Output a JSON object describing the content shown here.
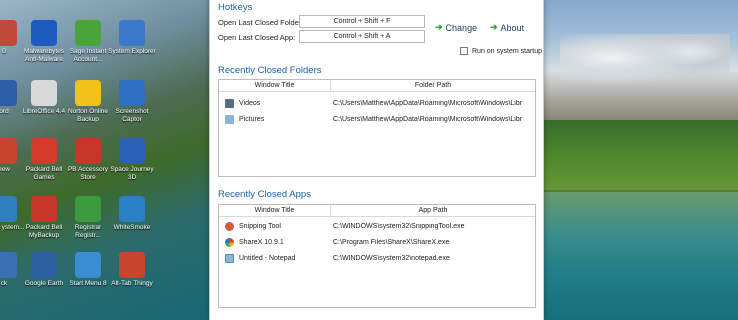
{
  "desktop": {
    "icons": [
      {
        "label": "G",
        "color": "#c04a3a"
      },
      {
        "label": "Malwarebytes Anti-Malware",
        "color": "#1e5bbf"
      },
      {
        "label": "Sage Instant Account...",
        "color": "#4aa33a"
      },
      {
        "label": "System Explorer",
        "color": "#3a78c9"
      },
      {
        "label": "ord",
        "color": "#2c5fa8"
      },
      {
        "label": "LibreOffice 4.4",
        "color": "#d8d8d8"
      },
      {
        "label": "Norton Online Backup",
        "color": "#f2c21b"
      },
      {
        "label": "Screenshot Captor",
        "color": "#2e6fc2"
      },
      {
        "label": "hew",
        "color": "#c8442e"
      },
      {
        "label": "Packard Bell Games",
        "color": "#d43a2a"
      },
      {
        "label": "PB Accessory Store",
        "color": "#c8362a"
      },
      {
        "label": "Space Journey 3D",
        "color": "#2b60b8"
      },
      {
        "label": "ontrol ystem...",
        "color": "#2f7fbf"
      },
      {
        "label": "Packard Bell MyBackup",
        "color": "#c8362a"
      },
      {
        "label": "Registrar Registr...",
        "color": "#3b9a3b"
      },
      {
        "label": "WhiteSmoke",
        "color": "#2a7fc6"
      },
      {
        "label": "ck",
        "color": "#3a6fb5"
      },
      {
        "label": "Google Earth",
        "color": "#2a5fa0"
      },
      {
        "label": "Start Menu 8",
        "color": "#3a8dd0"
      },
      {
        "label": "Alt-Tab Thingy",
        "color": "#c8442e"
      }
    ]
  },
  "window": {
    "hotkeys": {
      "title": "Hotkeys",
      "folder_label": "Open Last Closed Folder:",
      "folder_value": "Control + Shift + F",
      "app_label": "Open Last Closed App:",
      "app_value": "Control + Shift + A",
      "change_label": "Change",
      "about_label": "About",
      "startup_label": "Run on system startup"
    },
    "folders": {
      "title": "Recently Closed Folders",
      "col1": "Window Title",
      "col2": "Folder Path",
      "rows": [
        {
          "title": "Videos",
          "path": "C:\\Users\\Matthew\\AppData\\Roaming\\Microsoft\\Windows\\Libr"
        },
        {
          "title": "Pictures",
          "path": "C:\\Users\\Matthew\\AppData\\Roaming\\Microsoft\\Windows\\Libr"
        }
      ]
    },
    "apps": {
      "title": "Recently Closed Apps",
      "col1": "Window Title",
      "col2": "App Path",
      "rows": [
        {
          "title": "Snipping Tool",
          "path": "C:\\WINDOWS\\system32\\SnippingTool.exe"
        },
        {
          "title": "ShareX 10.9.1",
          "path": "C:\\Program Files\\ShareX\\ShareX.exe"
        },
        {
          "title": "Untitled - Notepad",
          "path": "C:\\WINDOWS\\system32\\notepad.exe"
        }
      ]
    }
  }
}
